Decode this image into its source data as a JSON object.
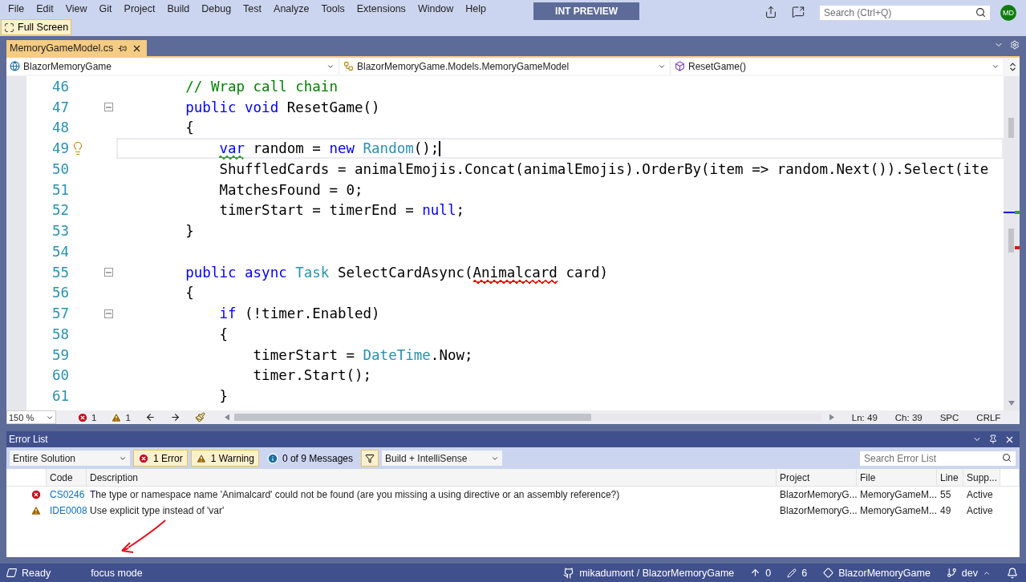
{
  "menu": [
    "File",
    "Edit",
    "View",
    "Git",
    "Project",
    "Build",
    "Debug",
    "Test",
    "Analyze",
    "Tools",
    "Extensions",
    "Window",
    "Help"
  ],
  "preview_badge": "INT PREVIEW",
  "search": {
    "placeholder": "Search (Ctrl+Q)"
  },
  "avatar": "MD",
  "full_screen": "Full Screen",
  "tabs": [
    {
      "label": "MemoryGameModel.cs",
      "selected": true
    }
  ],
  "navigation": {
    "project": "BlazorMemoryGame",
    "type": "BlazorMemoryGame.Models.MemoryGameModel",
    "member": "ResetGame()"
  },
  "code_lines": [
    {
      "number": "46",
      "tokens": [
        {
          "kind": "comment",
          "text": "        // Wrap call chain"
        }
      ]
    },
    {
      "number": "47",
      "fold": true,
      "tokens": [
        {
          "kind": "kw",
          "text": "        public void"
        },
        {
          "kind": "plain",
          "text": " ResetGame()"
        }
      ]
    },
    {
      "number": "48",
      "tokens": [
        {
          "kind": "plain",
          "text": "        {"
        }
      ]
    },
    {
      "number": "49",
      "current": true,
      "lightbulb": true,
      "tokens": [
        {
          "kind": "kw",
          "text": "            var",
          "squiggle": true,
          "color": "#3ca03c"
        },
        {
          "kind": "plain",
          "text": " random = "
        },
        {
          "kind": "kw",
          "text": "new"
        },
        {
          "kind": "type",
          "text": " Random"
        },
        {
          "kind": "plain",
          "text": "();"
        }
      ]
    },
    {
      "number": "50",
      "tokens": [
        {
          "kind": "plain",
          "text": "            ShuffledCards = animalEmojis.Concat(animalEmojis).OrderBy(item => random.Next()).Select(ite"
        }
      ]
    },
    {
      "number": "51",
      "tokens": [
        {
          "kind": "plain",
          "text": "            MatchesFound = 0;"
        }
      ]
    },
    {
      "number": "52",
      "tokens": [
        {
          "kind": "plain",
          "text": "            timerStart = timerEnd = "
        },
        {
          "kind": "kw",
          "text": "null"
        },
        {
          "kind": "plain",
          "text": ";"
        }
      ]
    },
    {
      "number": "53",
      "tokens": [
        {
          "kind": "plain",
          "text": "        }"
        }
      ]
    },
    {
      "number": "54"
    },
    {
      "number": "55",
      "fold": true,
      "tokens": [
        {
          "kind": "kw",
          "text": "        public async"
        },
        {
          "kind": "type",
          "text": " Task"
        },
        {
          "kind": "plain",
          "text": " SelectCardAsync("
        },
        {
          "kind": "plain",
          "text": "Animalcard",
          "squiggle": true,
          "color": "#e51400"
        },
        {
          "kind": "plain",
          "text": " card)"
        }
      ]
    },
    {
      "number": "56",
      "tokens": [
        {
          "kind": "plain",
          "text": "        {"
        }
      ]
    },
    {
      "number": "57",
      "fold": true,
      "tokens": [
        {
          "kind": "kw",
          "text": "            if"
        },
        {
          "kind": "plain",
          "text": " (!timer.Enabled)"
        }
      ]
    },
    {
      "number": "58",
      "tokens": [
        {
          "kind": "plain",
          "text": "            {"
        }
      ]
    },
    {
      "number": "59",
      "tokens": [
        {
          "kind": "plain",
          "text": "                timerStart = "
        },
        {
          "kind": "type",
          "text": "DateTime"
        },
        {
          "kind": "plain",
          "text": ".Now;"
        }
      ]
    },
    {
      "number": "60",
      "tokens": [
        {
          "kind": "plain",
          "text": "                timer.Start();"
        }
      ]
    },
    {
      "number": "61",
      "tokens": [
        {
          "kind": "plain",
          "text": "            }"
        }
      ]
    }
  ],
  "editor_status": {
    "zoom": "150 %",
    "errors": "1",
    "warnings": "1",
    "line": "Ln: 49",
    "column": "Ch: 39",
    "whitespace": "SPC",
    "line_ending": "CRLF"
  },
  "error_list": {
    "title": "Error List",
    "scope": "Entire Solution",
    "filters": [
      {
        "kind": "error",
        "label": "1 Error",
        "on": true
      },
      {
        "kind": "warning",
        "label": "1 Warning",
        "on": true
      },
      {
        "kind": "info",
        "label": "0 of 9 Messages",
        "on": false
      }
    ],
    "source": "Build + IntelliSense",
    "search_placeholder": "Search Error List",
    "columns": [
      "Code",
      "Description",
      "Project",
      "File",
      "Line",
      "Supp..."
    ],
    "rows": [
      {
        "kind": "error",
        "code": "CS0246",
        "description": "The type or namespace name 'Animalcard' could not be found (are you missing a using directive or an assembly reference?)",
        "project": "BlazorMemoryG...",
        "file": "MemoryGameM...",
        "line": "55",
        "suppression": "Active"
      },
      {
        "kind": "warning",
        "code": "IDE0008",
        "description": "Use explicit type instead of 'var'",
        "project": "BlazorMemoryG...",
        "file": "MemoryGameM...",
        "line": "49",
        "suppression": "Active"
      }
    ]
  },
  "status_bar": {
    "state": "Ready",
    "mode": "focus mode",
    "repository": "mikadumont / BlazorMemoryGame",
    "pushes": "0",
    "changes": "6",
    "branch_repo": "BlazorMemoryGame",
    "branch": "dev"
  }
}
